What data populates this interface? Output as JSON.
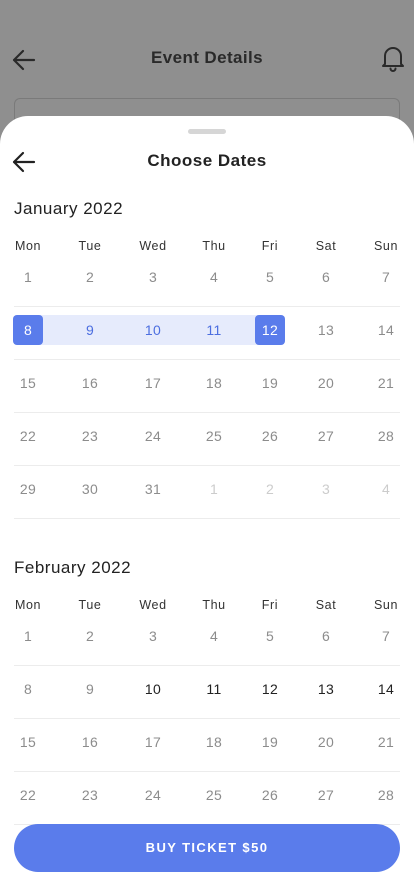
{
  "background": {
    "title": "Event Details"
  },
  "sheet": {
    "title": "Choose Dates"
  },
  "weekdays": [
    "Mon",
    "Tue",
    "Wed",
    "Thu",
    "Fri",
    "Sat",
    "Sun"
  ],
  "months": [
    {
      "title": "January 2022",
      "weeks": [
        [
          {
            "d": "1"
          },
          {
            "d": "2"
          },
          {
            "d": "3"
          },
          {
            "d": "4"
          },
          {
            "d": "5"
          },
          {
            "d": "6"
          },
          {
            "d": "7"
          }
        ],
        [
          {
            "d": "8",
            "state": "selected"
          },
          {
            "d": "9",
            "state": "in-range"
          },
          {
            "d": "10",
            "state": "in-range"
          },
          {
            "d": "11",
            "state": "in-range"
          },
          {
            "d": "12",
            "state": "selected"
          },
          {
            "d": "13"
          },
          {
            "d": "14"
          }
        ],
        [
          {
            "d": "15"
          },
          {
            "d": "16"
          },
          {
            "d": "17"
          },
          {
            "d": "18"
          },
          {
            "d": "19"
          },
          {
            "d": "20"
          },
          {
            "d": "21"
          }
        ],
        [
          {
            "d": "22"
          },
          {
            "d": "23"
          },
          {
            "d": "24"
          },
          {
            "d": "25"
          },
          {
            "d": "26"
          },
          {
            "d": "27"
          },
          {
            "d": "28"
          }
        ],
        [
          {
            "d": "29"
          },
          {
            "d": "30"
          },
          {
            "d": "31"
          },
          {
            "d": "1",
            "state": "muted"
          },
          {
            "d": "2",
            "state": "muted"
          },
          {
            "d": "3",
            "state": "muted"
          },
          {
            "d": "4",
            "state": "muted"
          }
        ]
      ]
    },
    {
      "title": "February 2022",
      "weeks": [
        [
          {
            "d": "1"
          },
          {
            "d": "2"
          },
          {
            "d": "3"
          },
          {
            "d": "4"
          },
          {
            "d": "5"
          },
          {
            "d": "6"
          },
          {
            "d": "7"
          }
        ],
        [
          {
            "d": "8"
          },
          {
            "d": "9"
          },
          {
            "d": "10",
            "state": "bold"
          },
          {
            "d": "11",
            "state": "bold"
          },
          {
            "d": "12",
            "state": "bold"
          },
          {
            "d": "13",
            "state": "bold"
          },
          {
            "d": "14",
            "state": "bold"
          }
        ],
        [
          {
            "d": "15"
          },
          {
            "d": "16"
          },
          {
            "d": "17"
          },
          {
            "d": "18"
          },
          {
            "d": "19"
          },
          {
            "d": "20"
          },
          {
            "d": "21"
          }
        ],
        [
          {
            "d": "22"
          },
          {
            "d": "23"
          },
          {
            "d": "24"
          },
          {
            "d": "25"
          },
          {
            "d": "26"
          },
          {
            "d": "27"
          },
          {
            "d": "28"
          }
        ]
      ]
    }
  ],
  "buy_button": {
    "label": "BUY TICKET $50"
  },
  "colors": {
    "accent": "#5a7ceb",
    "range_bg": "#e6ebfc",
    "overlay": "#8f8f8f"
  },
  "icons": {
    "back": "arrow-left-icon",
    "notifications": "bell-icon"
  }
}
